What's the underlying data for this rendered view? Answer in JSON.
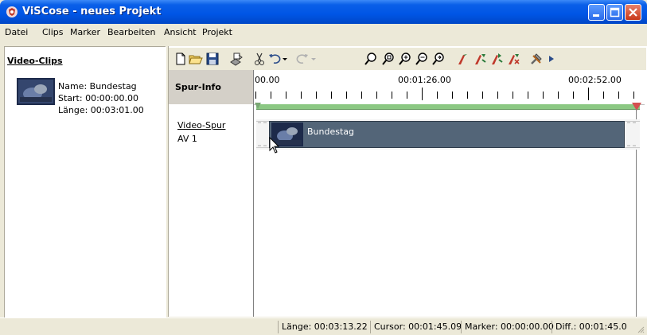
{
  "window": {
    "title": "ViSCose - neues Projekt"
  },
  "menu": [
    "Datei",
    "Clips",
    "Marker",
    "Bearbeiten",
    "Ansicht",
    "Projekt"
  ],
  "clips_panel": {
    "title": "Video-Clips",
    "clip": {
      "name": "Name:  Bundestag",
      "start": "Start:   00:00:00.00",
      "length": "Länge:  00:03:01.00"
    }
  },
  "toolbar_icons": [
    "new-icon",
    "open-icon",
    "save-icon",
    "export-icon",
    "cut-icon",
    "undo-icon",
    "redo-icon",
    "zoom-icon",
    "zoom-fit-icon",
    "zoom-in-icon",
    "zoom-out-icon",
    "zoom-selection-icon",
    "marker-icon",
    "marker-add-icon",
    "marker-next-icon",
    "marker-delete-icon",
    "tools-icon",
    "more-icon"
  ],
  "timeline": {
    "spur_info_header": "Spur-Info",
    "ruler_labels": [
      "00.00",
      "00:01:26.00",
      "00:02:52.00"
    ],
    "track_name": "Video-Spur",
    "track_id": "AV 1",
    "clip_label": "Bundestag"
  },
  "status": {
    "length": "Länge:  00:03:13.22",
    "cursor": "Cursor: 00:01:45.09",
    "marker": "Marker: 00:00:00.00",
    "diff": "Diff.:  00:01:45.0"
  }
}
